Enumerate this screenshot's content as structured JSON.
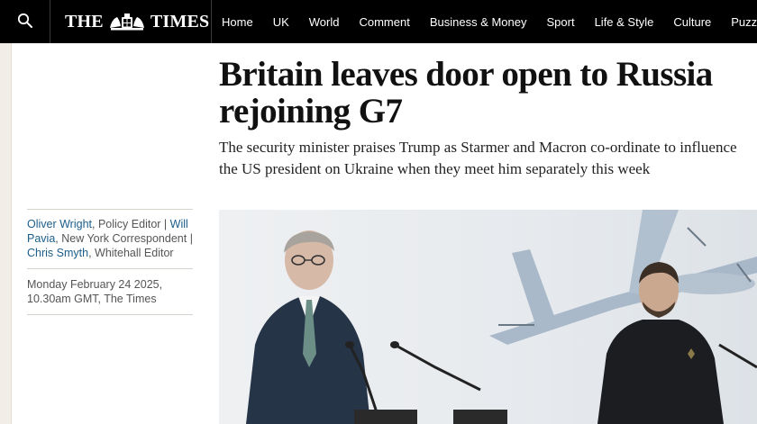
{
  "masthead": {
    "logo_left": "THE",
    "logo_right": "TIMES"
  },
  "nav": {
    "items": [
      "Home",
      "UK",
      "World",
      "Comment",
      "Business & Money",
      "Sport",
      "Life & Style",
      "Culture",
      "Puzzles"
    ]
  },
  "article": {
    "headline": "Britain leaves door open to Russia rejoining G7",
    "standfirst": "The security minister praises Trump as Starmer and Macron co-ordinate to influence the US president on Ukraine when they meet him separately this week",
    "authors": [
      {
        "name": "Oliver Wright",
        "role": "Policy Editor"
      },
      {
        "name": "Will Pavia",
        "role": "New York Correspondent"
      },
      {
        "name": "Chris Smyth",
        "role": "Whitehall Editor"
      }
    ],
    "date": "Monday February 24 2025, 10.30am GMT, The Times"
  },
  "colors": {
    "nav_background": "#000000",
    "byline_link": "#1b5d8a",
    "left_edge": "#f2ede6"
  },
  "icons": {
    "search": "search-icon",
    "crest": "royal-crest-icon"
  }
}
